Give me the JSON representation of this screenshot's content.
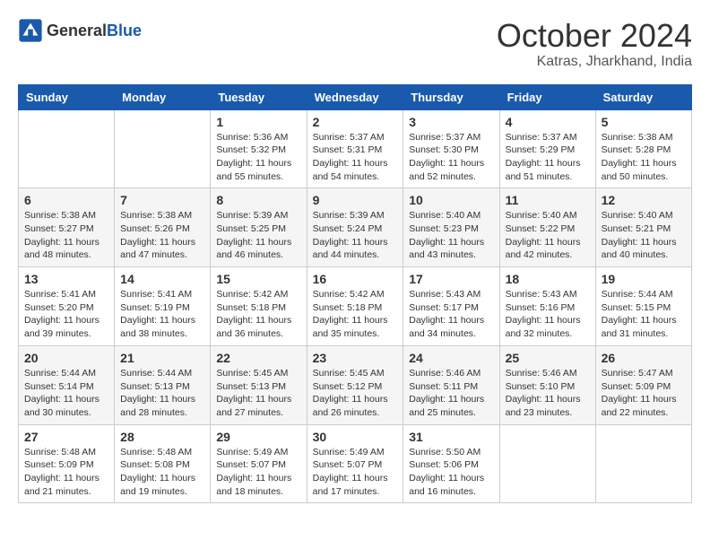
{
  "header": {
    "logo_general": "General",
    "logo_blue": "Blue",
    "month": "October 2024",
    "location": "Katras, Jharkhand, India"
  },
  "columns": [
    "Sunday",
    "Monday",
    "Tuesday",
    "Wednesday",
    "Thursday",
    "Friday",
    "Saturday"
  ],
  "weeks": [
    [
      {
        "day": "",
        "info": ""
      },
      {
        "day": "",
        "info": ""
      },
      {
        "day": "1",
        "info": "Sunrise: 5:36 AM\nSunset: 5:32 PM\nDaylight: 11 hours and 55 minutes."
      },
      {
        "day": "2",
        "info": "Sunrise: 5:37 AM\nSunset: 5:31 PM\nDaylight: 11 hours and 54 minutes."
      },
      {
        "day": "3",
        "info": "Sunrise: 5:37 AM\nSunset: 5:30 PM\nDaylight: 11 hours and 52 minutes."
      },
      {
        "day": "4",
        "info": "Sunrise: 5:37 AM\nSunset: 5:29 PM\nDaylight: 11 hours and 51 minutes."
      },
      {
        "day": "5",
        "info": "Sunrise: 5:38 AM\nSunset: 5:28 PM\nDaylight: 11 hours and 50 minutes."
      }
    ],
    [
      {
        "day": "6",
        "info": "Sunrise: 5:38 AM\nSunset: 5:27 PM\nDaylight: 11 hours and 48 minutes."
      },
      {
        "day": "7",
        "info": "Sunrise: 5:38 AM\nSunset: 5:26 PM\nDaylight: 11 hours and 47 minutes."
      },
      {
        "day": "8",
        "info": "Sunrise: 5:39 AM\nSunset: 5:25 PM\nDaylight: 11 hours and 46 minutes."
      },
      {
        "day": "9",
        "info": "Sunrise: 5:39 AM\nSunset: 5:24 PM\nDaylight: 11 hours and 44 minutes."
      },
      {
        "day": "10",
        "info": "Sunrise: 5:40 AM\nSunset: 5:23 PM\nDaylight: 11 hours and 43 minutes."
      },
      {
        "day": "11",
        "info": "Sunrise: 5:40 AM\nSunset: 5:22 PM\nDaylight: 11 hours and 42 minutes."
      },
      {
        "day": "12",
        "info": "Sunrise: 5:40 AM\nSunset: 5:21 PM\nDaylight: 11 hours and 40 minutes."
      }
    ],
    [
      {
        "day": "13",
        "info": "Sunrise: 5:41 AM\nSunset: 5:20 PM\nDaylight: 11 hours and 39 minutes."
      },
      {
        "day": "14",
        "info": "Sunrise: 5:41 AM\nSunset: 5:19 PM\nDaylight: 11 hours and 38 minutes."
      },
      {
        "day": "15",
        "info": "Sunrise: 5:42 AM\nSunset: 5:18 PM\nDaylight: 11 hours and 36 minutes."
      },
      {
        "day": "16",
        "info": "Sunrise: 5:42 AM\nSunset: 5:18 PM\nDaylight: 11 hours and 35 minutes."
      },
      {
        "day": "17",
        "info": "Sunrise: 5:43 AM\nSunset: 5:17 PM\nDaylight: 11 hours and 34 minutes."
      },
      {
        "day": "18",
        "info": "Sunrise: 5:43 AM\nSunset: 5:16 PM\nDaylight: 11 hours and 32 minutes."
      },
      {
        "day": "19",
        "info": "Sunrise: 5:44 AM\nSunset: 5:15 PM\nDaylight: 11 hours and 31 minutes."
      }
    ],
    [
      {
        "day": "20",
        "info": "Sunrise: 5:44 AM\nSunset: 5:14 PM\nDaylight: 11 hours and 30 minutes."
      },
      {
        "day": "21",
        "info": "Sunrise: 5:44 AM\nSunset: 5:13 PM\nDaylight: 11 hours and 28 minutes."
      },
      {
        "day": "22",
        "info": "Sunrise: 5:45 AM\nSunset: 5:13 PM\nDaylight: 11 hours and 27 minutes."
      },
      {
        "day": "23",
        "info": "Sunrise: 5:45 AM\nSunset: 5:12 PM\nDaylight: 11 hours and 26 minutes."
      },
      {
        "day": "24",
        "info": "Sunrise: 5:46 AM\nSunset: 5:11 PM\nDaylight: 11 hours and 25 minutes."
      },
      {
        "day": "25",
        "info": "Sunrise: 5:46 AM\nSunset: 5:10 PM\nDaylight: 11 hours and 23 minutes."
      },
      {
        "day": "26",
        "info": "Sunrise: 5:47 AM\nSunset: 5:09 PM\nDaylight: 11 hours and 22 minutes."
      }
    ],
    [
      {
        "day": "27",
        "info": "Sunrise: 5:48 AM\nSunset: 5:09 PM\nDaylight: 11 hours and 21 minutes."
      },
      {
        "day": "28",
        "info": "Sunrise: 5:48 AM\nSunset: 5:08 PM\nDaylight: 11 hours and 19 minutes."
      },
      {
        "day": "29",
        "info": "Sunrise: 5:49 AM\nSunset: 5:07 PM\nDaylight: 11 hours and 18 minutes."
      },
      {
        "day": "30",
        "info": "Sunrise: 5:49 AM\nSunset: 5:07 PM\nDaylight: 11 hours and 17 minutes."
      },
      {
        "day": "31",
        "info": "Sunrise: 5:50 AM\nSunset: 5:06 PM\nDaylight: 11 hours and 16 minutes."
      },
      {
        "day": "",
        "info": ""
      },
      {
        "day": "",
        "info": ""
      }
    ]
  ]
}
